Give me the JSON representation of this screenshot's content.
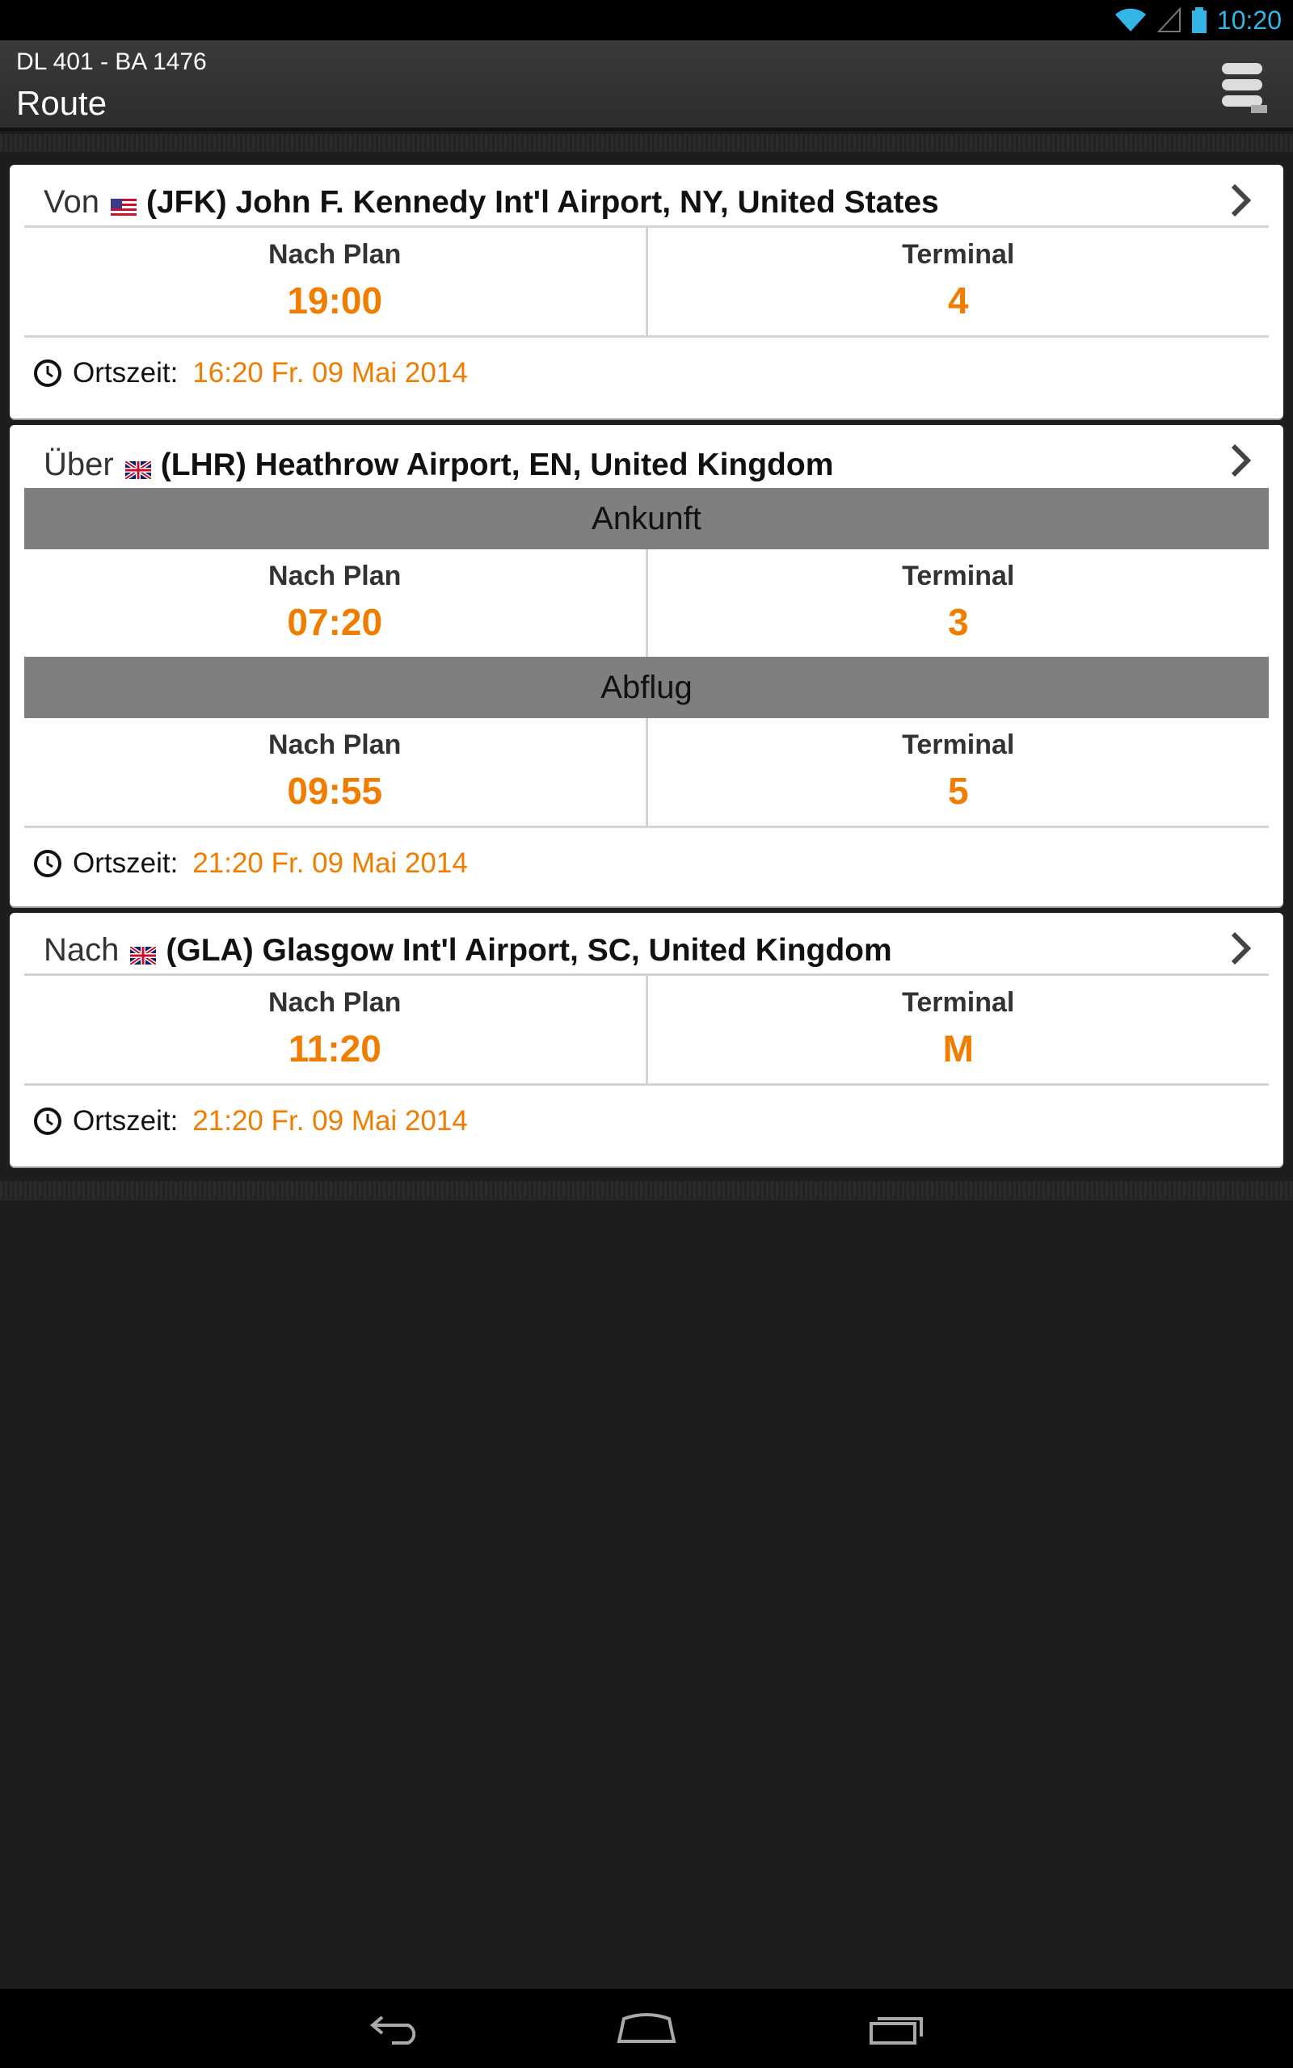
{
  "status_bar": {
    "time": "10:20",
    "icons": [
      "wifi-icon",
      "signal-icon",
      "battery-icon"
    ]
  },
  "action_bar": {
    "subtitle": "DL 401 - BA 1476",
    "title": "Route",
    "menu_icon": "menu-icon"
  },
  "colors": {
    "accent": "#f07d00",
    "status_blue": "#33b5e5",
    "band_gray": "#7f7f7f"
  },
  "route": {
    "origin": {
      "prefix": "Von",
      "flag": "us-flag-icon",
      "airport": "(JFK) John F. Kennedy Int'l Airport, NY, United States",
      "plan_label": "Nach Plan",
      "plan_time": "19:00",
      "terminal_label": "Terminal",
      "terminal": "4",
      "local_label": "Ortszeit:",
      "local_time": "16:20 Fr. 09 Mai 2014"
    },
    "via": {
      "prefix": "Über",
      "flag": "uk-flag-icon",
      "airport": "(LHR) Heathrow Airport, EN, United Kingdom",
      "arrival_band": "Ankunft",
      "arrival_plan_label": "Nach Plan",
      "arrival_plan_time": "07:20",
      "arrival_terminal_label": "Terminal",
      "arrival_terminal": "3",
      "departure_band": "Abflug",
      "departure_plan_label": "Nach Plan",
      "departure_plan_time": "09:55",
      "departure_terminal_label": "Terminal",
      "departure_terminal": "5",
      "local_label": "Ortszeit:",
      "local_time": "21:20 Fr. 09 Mai 2014"
    },
    "destination": {
      "prefix": "Nach",
      "flag": "uk-flag-icon",
      "airport": "(GLA) Glasgow Int'l Airport, SC, United Kingdom",
      "plan_label": "Nach Plan",
      "plan_time": "11:20",
      "terminal_label": "Terminal",
      "terminal": "M",
      "local_label": "Ortszeit:",
      "local_time": "21:20 Fr. 09 Mai 2014"
    }
  },
  "nav_bar": {
    "buttons": [
      "back-icon",
      "home-icon",
      "recent-apps-icon"
    ]
  }
}
